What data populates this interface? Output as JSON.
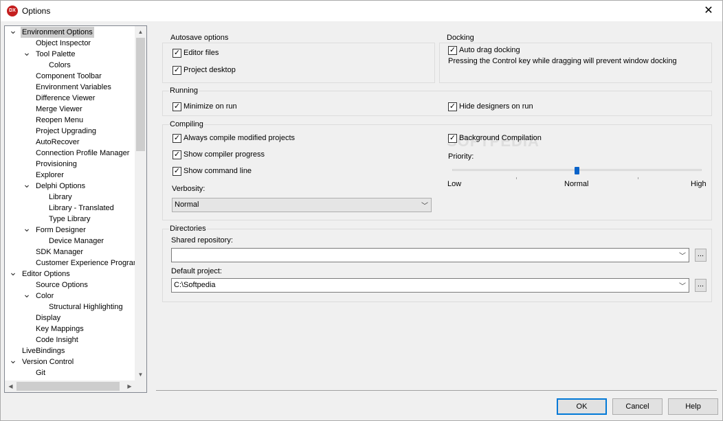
{
  "window": {
    "title": "Options",
    "app_icon_text": "DX"
  },
  "tree": {
    "items": [
      {
        "label": "Environment Options",
        "level": 0,
        "expanded": true,
        "selected": true
      },
      {
        "label": "Object Inspector",
        "level": 1
      },
      {
        "label": "Tool Palette",
        "level": 1,
        "expanded": true
      },
      {
        "label": "Colors",
        "level": 2
      },
      {
        "label": "Component Toolbar",
        "level": 1
      },
      {
        "label": "Environment Variables",
        "level": 1
      },
      {
        "label": "Difference Viewer",
        "level": 1
      },
      {
        "label": "Merge Viewer",
        "level": 1
      },
      {
        "label": "Reopen Menu",
        "level": 1
      },
      {
        "label": "Project Upgrading",
        "level": 1
      },
      {
        "label": "AutoRecover",
        "level": 1
      },
      {
        "label": "Connection Profile Manager",
        "level": 1
      },
      {
        "label": "Provisioning",
        "level": 1
      },
      {
        "label": "Explorer",
        "level": 1
      },
      {
        "label": "Delphi Options",
        "level": 1,
        "expanded": true
      },
      {
        "label": "Library",
        "level": 2
      },
      {
        "label": "Library - Translated",
        "level": 2
      },
      {
        "label": "Type Library",
        "level": 2
      },
      {
        "label": "Form Designer",
        "level": 1,
        "expanded": true
      },
      {
        "label": "Device Manager",
        "level": 2
      },
      {
        "label": "SDK Manager",
        "level": 1
      },
      {
        "label": "Customer Experience Program",
        "level": 1
      },
      {
        "label": "Editor Options",
        "level": 0,
        "expanded": true
      },
      {
        "label": "Source Options",
        "level": 1
      },
      {
        "label": "Color",
        "level": 1,
        "expanded": true
      },
      {
        "label": "Structural Highlighting",
        "level": 2
      },
      {
        "label": "Display",
        "level": 1
      },
      {
        "label": "Key Mappings",
        "level": 1
      },
      {
        "label": "Code Insight",
        "level": 1
      },
      {
        "label": "LiveBindings",
        "level": 0
      },
      {
        "label": "Version Control",
        "level": 0,
        "expanded": true
      },
      {
        "label": "Git",
        "level": 1
      }
    ]
  },
  "autosave": {
    "title": "Autosave options",
    "editor_files": {
      "label": "Editor files",
      "checked": true
    },
    "project_desktop": {
      "label": "Project desktop",
      "checked": true
    }
  },
  "docking": {
    "title": "Docking",
    "auto_drag": {
      "label": "Auto drag docking",
      "checked": true
    },
    "note": "Pressing the Control key while dragging will prevent window docking"
  },
  "running": {
    "title": "Running",
    "minimize": {
      "label": "Minimize on run",
      "checked": true
    },
    "hide_designers": {
      "label": "Hide designers on run",
      "checked": true
    }
  },
  "compiling": {
    "title": "Compiling",
    "always_compile": {
      "label": "Always compile modified projects",
      "checked": true
    },
    "show_progress": {
      "label": "Show compiler progress",
      "checked": true
    },
    "show_cmdline": {
      "label": "Show command line",
      "checked": true
    },
    "background": {
      "label": "Background Compilation",
      "checked": true
    },
    "priority_label": "Priority:",
    "priority_low": "Low",
    "priority_normal": "Normal",
    "priority_high": "High",
    "priority_value": 0.5,
    "verbosity_label": "Verbosity:",
    "verbosity_value": "Normal"
  },
  "directories": {
    "title": "Directories",
    "shared_label": "Shared repository:",
    "shared_value": "",
    "default_label": "Default project:",
    "default_value": "C:\\Softpedia",
    "browse": "..."
  },
  "buttons": {
    "ok": "OK",
    "cancel": "Cancel",
    "help": "Help"
  },
  "watermark": "SOFTPEDIA"
}
